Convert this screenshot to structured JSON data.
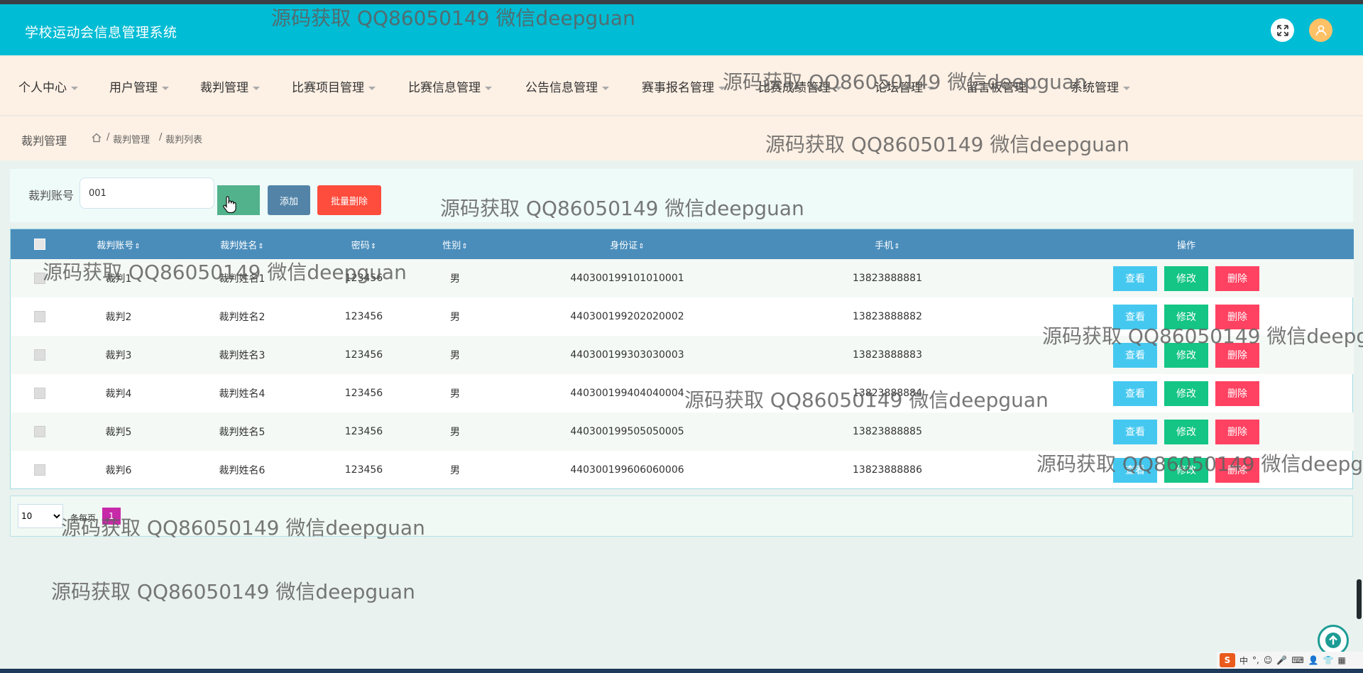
{
  "app": {
    "title": "学校运动会信息管理系统"
  },
  "nav": {
    "items": [
      "个人中心",
      "用户管理",
      "裁判管理",
      "比赛项目管理",
      "比赛信息管理",
      "公告信息管理",
      "赛事报名管理",
      "比赛成绩管理",
      "论坛管理",
      "留言板管理",
      "系统管理"
    ]
  },
  "breadcrumb": {
    "title": "裁判管理",
    "path1": "裁判管理",
    "sep": "/",
    "path2": "裁判列表"
  },
  "search": {
    "label": "裁判账号",
    "value": "001",
    "add_label": "添加",
    "batch_delete_label": "批量删除"
  },
  "table": {
    "headers": [
      "裁判账号",
      "裁判姓名",
      "密码",
      "性别",
      "身份证",
      "手机",
      "操作"
    ],
    "sort_icon": "⇕",
    "action_labels": {
      "view": "查看",
      "edit": "修改",
      "delete": "删除"
    },
    "rows": [
      {
        "account": "裁判1",
        "name": "裁判姓名1",
        "password": "123456",
        "gender": "男",
        "id_card": "440300199101010001",
        "phone": "13823888881"
      },
      {
        "account": "裁判2",
        "name": "裁判姓名2",
        "password": "123456",
        "gender": "男",
        "id_card": "440300199202020002",
        "phone": "13823888882"
      },
      {
        "account": "裁判3",
        "name": "裁判姓名3",
        "password": "123456",
        "gender": "男",
        "id_card": "440300199303030003",
        "phone": "13823888883"
      },
      {
        "account": "裁判4",
        "name": "裁判姓名4",
        "password": "123456",
        "gender": "男",
        "id_card": "440300199404040004",
        "phone": "13823888884"
      },
      {
        "account": "裁判5",
        "name": "裁判姓名5",
        "password": "123456",
        "gender": "男",
        "id_card": "440300199505050005",
        "phone": "13823888885"
      },
      {
        "account": "裁判6",
        "name": "裁判姓名6",
        "password": "123456",
        "gender": "男",
        "id_card": "440300199606060006",
        "phone": "13823888886"
      }
    ]
  },
  "pager": {
    "page_size": "10",
    "per_page_label": "条每页",
    "current_page": "1"
  },
  "watermark": "源码获取 QQ86050149 微信deepguan",
  "ime": {
    "lang": "中"
  },
  "colors": {
    "header": "#00bcd4",
    "table_header": "#4a8dbb",
    "view": "#45c8f0",
    "edit": "#14c585",
    "delete": "#ff4261"
  }
}
